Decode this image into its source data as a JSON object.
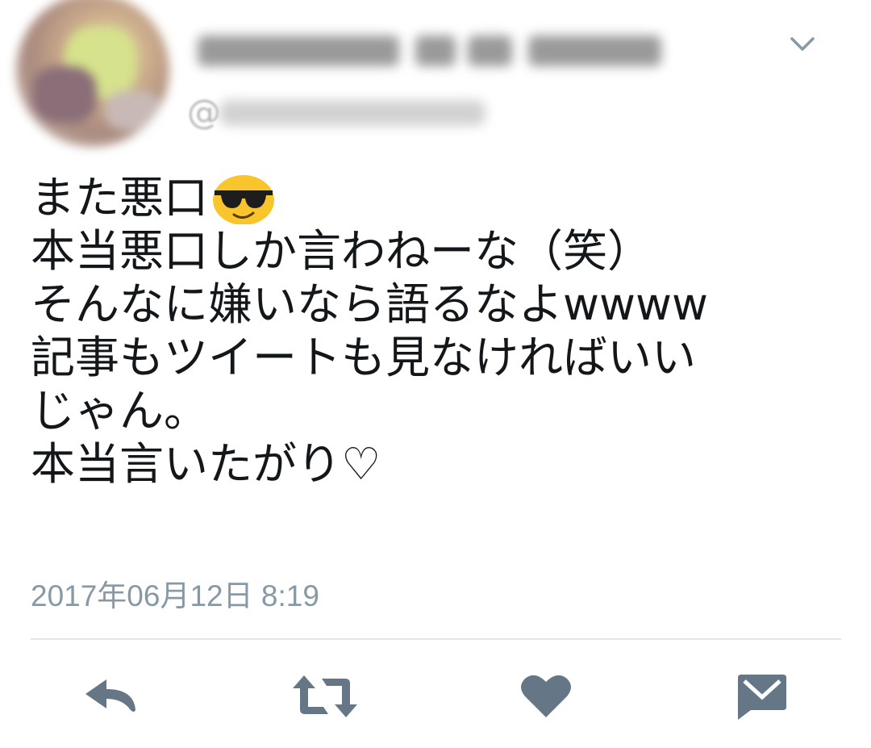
{
  "tweet": {
    "lines": [
      "また悪口",
      "本当悪口しか言わねーな（笑）",
      "そんなに嫌いなら語るなよwwww",
      "記事もツイートも見なければいい",
      "じゃん。",
      "本当言いたがり♡"
    ],
    "emoji_after_line_1": "smiling-face-with-sunglasses",
    "timestamp": "2017年06月12日 8:19",
    "handle_prefix": "@"
  },
  "actions": {
    "icons": [
      "reply-icon",
      "retweet-icon",
      "like-icon",
      "direct-message-icon"
    ]
  },
  "colors": {
    "text": "#14171a",
    "muted": "#8899a6",
    "icon": "#657786",
    "divider": "#e1e8ed",
    "emoji_yellow": "#f9c52d"
  }
}
